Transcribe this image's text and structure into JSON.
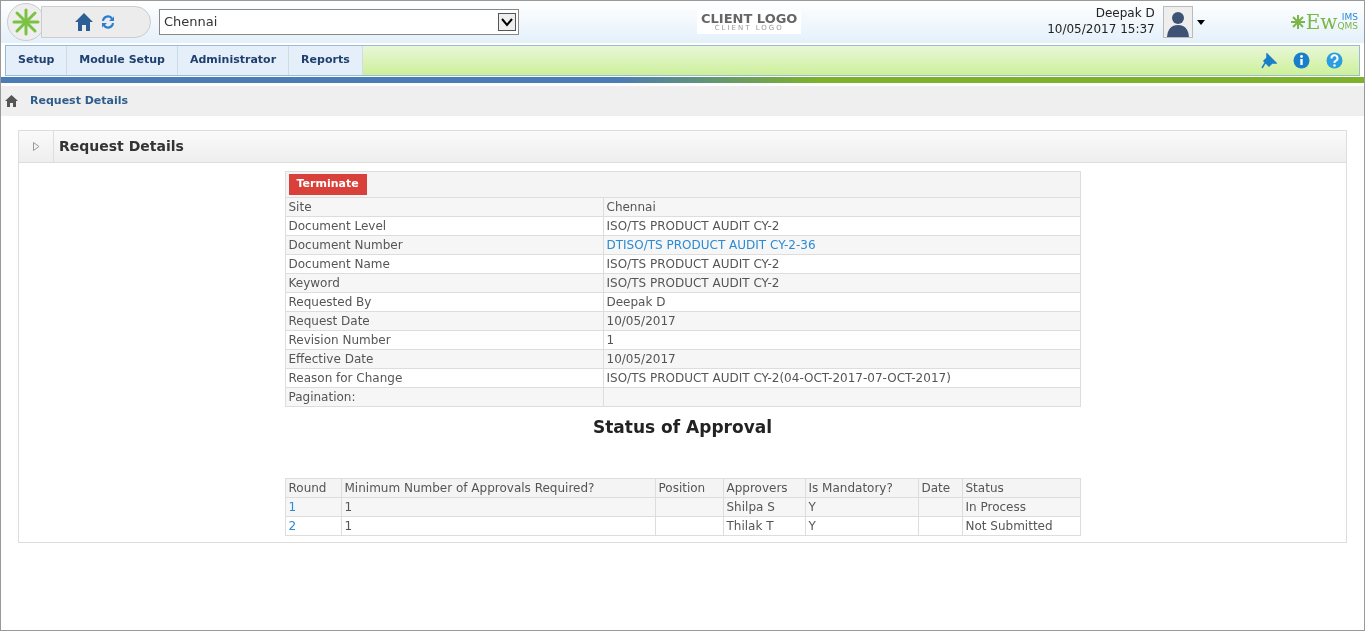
{
  "header": {
    "site_select": {
      "value": "Chennai"
    },
    "client_logo": {
      "title": "CLIENT LOGO",
      "subtitle": "CLIENT LOGO"
    },
    "user": {
      "name": "Deepak D",
      "datetime": "10/05/2017 15:37"
    },
    "brand": {
      "main": "Ew",
      "top": "IMS",
      "bottom": "QMS"
    }
  },
  "menu": [
    {
      "label": "Setup"
    },
    {
      "label": "Module Setup"
    },
    {
      "label": "Administrator"
    },
    {
      "label": "Reports"
    }
  ],
  "breadcrumb": [
    {
      "label": "Request Details"
    }
  ],
  "panel": {
    "title": "Request Details",
    "action": "Terminate",
    "details": [
      {
        "label": "Site",
        "value": "Chennai",
        "kind": "text"
      },
      {
        "label": "Document Level",
        "value": "ISO/TS PRODUCT AUDIT CY-2",
        "kind": "text"
      },
      {
        "label": "Document Number",
        "value": "DTISO/TS PRODUCT AUDIT CY-2-36",
        "kind": "link"
      },
      {
        "label": "Document Name",
        "value": "ISO/TS PRODUCT AUDIT CY-2",
        "kind": "text"
      },
      {
        "label": "Keyword",
        "value": "ISO/TS PRODUCT AUDIT CY-2",
        "kind": "text"
      },
      {
        "label": "Requested By",
        "value": "Deepak D",
        "kind": "text"
      },
      {
        "label": "Request Date",
        "value": "10/05/2017",
        "kind": "text"
      },
      {
        "label": "Revision Number",
        "value": "1",
        "kind": "text"
      },
      {
        "label": "Effective Date",
        "value": "10/05/2017",
        "kind": "text"
      },
      {
        "label": "Reason for Change",
        "value": "ISO/TS PRODUCT AUDIT CY-2(04-OCT-2017-07-OCT-2017)",
        "kind": "text"
      },
      {
        "label": "Pagination:"
      }
    ],
    "approval_title": "Status of Approval",
    "approval_table": {
      "columns": [
        "Round",
        "Minimum Number of Approvals Required?",
        "Position",
        "Approvers",
        "Is Mandatory?",
        "Date",
        "Status"
      ],
      "rows": [
        [
          "1",
          "1",
          "",
          "Shilpa S",
          "Y",
          "",
          "In Process"
        ],
        [
          "2",
          "1",
          "",
          "Thilak T",
          "Y",
          "",
          "Not Submitted"
        ]
      ]
    }
  }
}
